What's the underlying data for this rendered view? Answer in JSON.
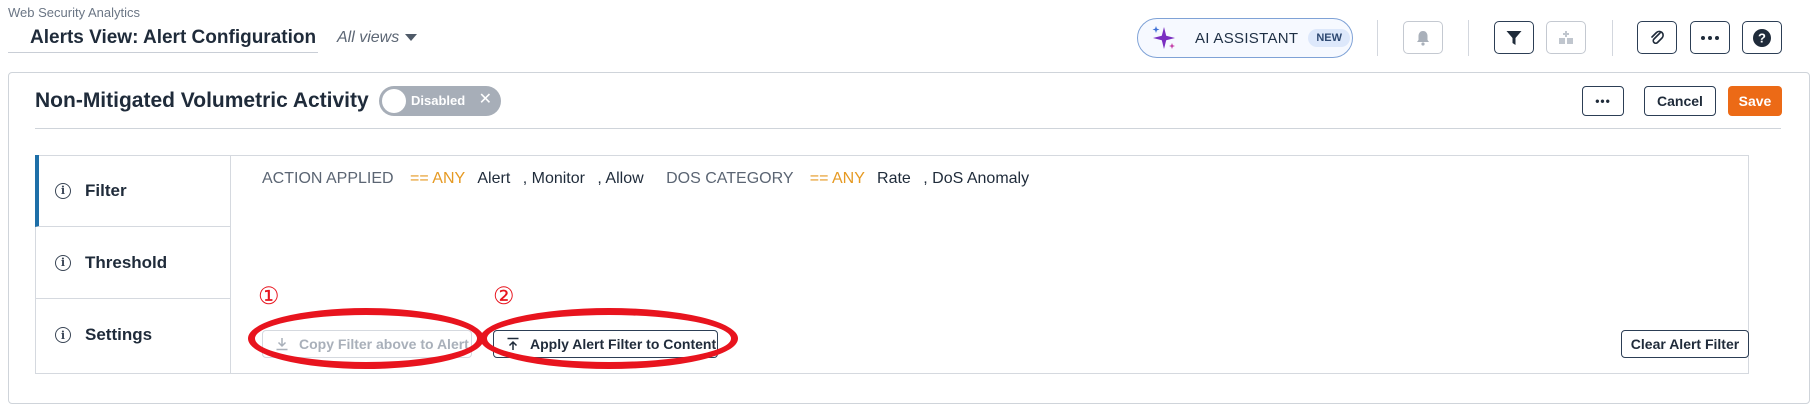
{
  "header": {
    "app_name": "Web Security Analytics",
    "page_title": "Alerts View: Alert Configuration",
    "views_label": "All views",
    "ai_assistant": {
      "label": "AI ASSISTANT",
      "badge": "NEW"
    },
    "icons": [
      "bell-icon",
      "filter-icon",
      "dashboard-add-icon",
      "attachment-icon",
      "more-icon",
      "help-icon"
    ]
  },
  "alert": {
    "name": "Non-Mitigated Volumetric Activity",
    "status": "Disabled",
    "more_label": "•••",
    "cancel_label": "Cancel",
    "save_label": "Save"
  },
  "nav": {
    "items": [
      {
        "label": "Filter",
        "active": true
      },
      {
        "label": "Threshold",
        "active": false
      },
      {
        "label": "Settings",
        "active": false
      }
    ]
  },
  "filter": {
    "field1": "ACTION APPLIED",
    "op1": "== ANY",
    "values1": [
      "Alert",
      ", Monitor",
      ", Allow"
    ],
    "field2": "DOS CATEGORY",
    "op2": "== ANY",
    "values2": [
      "Rate",
      ", DoS Anomaly"
    ]
  },
  "actions": {
    "copy_label": "Copy Filter above to Alert",
    "apply_label": "Apply Alert Filter to Content",
    "clear_label": "Clear Alert Filter"
  },
  "annotations": {
    "mark1": "①",
    "mark2": "②"
  },
  "colors": {
    "accent": "#ec6a16",
    "annotation": "#e8141e",
    "operator": "#e69a23",
    "active_nav": "#1e6fa8"
  }
}
